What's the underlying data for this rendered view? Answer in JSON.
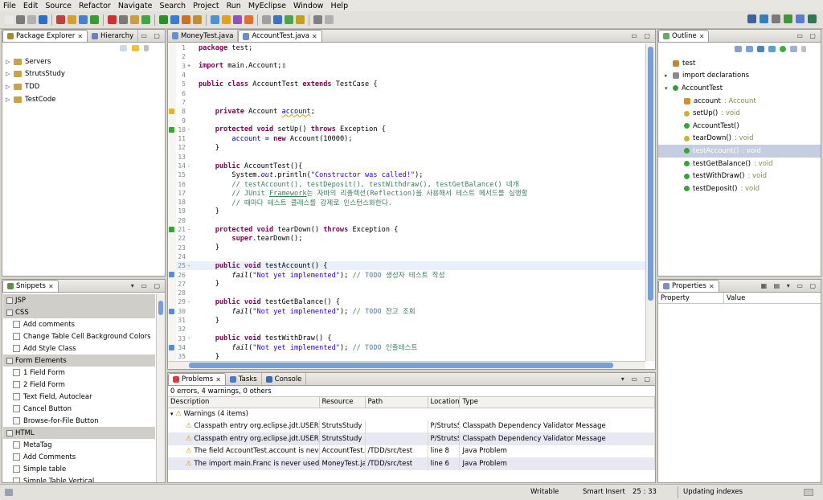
{
  "menu": [
    "File",
    "Edit",
    "Source",
    "Refactor",
    "Navigate",
    "Search",
    "Project",
    "Run",
    "MyEclipse",
    "Window",
    "Help"
  ],
  "package_explorer": {
    "tab_label": "Package Explorer",
    "tab2_label": "Hierarchy",
    "items": [
      "Servers",
      "StrutsStudy",
      "TDD",
      "TestCode"
    ]
  },
  "snippets": {
    "tab_label": "Snippets",
    "categories": [
      {
        "name": "JSP",
        "items": []
      },
      {
        "name": "CSS",
        "items": [
          "Add comments",
          "Change Table Cell Background Colors",
          "Add Style Class"
        ]
      },
      {
        "name": "Form Elements",
        "items": [
          "1 Field Form",
          "2 Field Form",
          "Text Field, Autoclear",
          "Cancel Button",
          "Browse-for-File Button"
        ]
      },
      {
        "name": "HTML",
        "items": [
          "MetaTag",
          "Add Comments",
          "Simple table",
          "Simple Table Vertical"
        ]
      }
    ]
  },
  "editor": {
    "tabs": [
      {
        "label": "MoneyTest.java",
        "active": false
      },
      {
        "label": "AccountTest.java",
        "active": true
      }
    ],
    "lines": [
      {
        "n": "1",
        "html": "<span class='kw'>package</span> test;"
      },
      {
        "n": "2",
        "html": ""
      },
      {
        "n": "3",
        "fold": "+",
        "html": "<span class='kw'>import</span> main.Account;&#9647;"
      },
      {
        "n": "4",
        "html": ""
      },
      {
        "n": "5",
        "html": "<span class='kw'>public class</span> AccountTest <span class='kw'>extends</span> TestCase {"
      },
      {
        "n": "6",
        "html": ""
      },
      {
        "n": "7",
        "html": ""
      },
      {
        "n": "8",
        "mark": "warn",
        "html": "    <span class='kw'>private</span> Account <span class='fld' style='text-decoration:underline wavy #d0a000'>account</span>;"
      },
      {
        "n": "9",
        "html": ""
      },
      {
        "n": "10",
        "fold": "-",
        "mark": "green",
        "html": "    <span class='kw'>protected void</span> setUp() <span class='kw'>throws</span> Exception {"
      },
      {
        "n": "11",
        "html": "        <span class='fld'>account</span> = <span class='kw'>new</span> Account(10000);"
      },
      {
        "n": "12",
        "html": "    }"
      },
      {
        "n": "13",
        "html": ""
      },
      {
        "n": "14",
        "fold": "-",
        "html": "    <span class='kw'>public</span> AccountTest(){"
      },
      {
        "n": "15",
        "html": "        System.<span class='fld it'>out</span>.println(<span class='str'>\"Constructor was called!\"</span>);"
      },
      {
        "n": "16",
        "html": "        <span class='cmt'>// testAccount(), testDeposit(), testWithdraw(), testGetBalance() 네개</span>"
      },
      {
        "n": "17",
        "html": "        <span class='cmt'>// JUnit <span style='text-decoration:underline'>Framework</span>는 자바의 리플렉션(Reflection)을 사용해서 테스트 메서드를 실행할</span>"
      },
      {
        "n": "18",
        "html": "        <span class='cmt'>// 때마다 테스트 클래스를 강제로 인스턴스화한다.</span>"
      },
      {
        "n": "19",
        "html": "    }"
      },
      {
        "n": "20",
        "html": ""
      },
      {
        "n": "21",
        "fold": "-",
        "mark": "green",
        "html": "    <span class='kw'>protected void</span> tearDown() <span class='kw'>throws</span> Exception {"
      },
      {
        "n": "22",
        "html": "        <span class='kw'>super</span>.tearDown();"
      },
      {
        "n": "23",
        "html": "    }"
      },
      {
        "n": "24",
        "html": ""
      },
      {
        "n": "25",
        "fold": "-",
        "hl": true,
        "html": "    <span class='kw'>public void</span> testAccount() {"
      },
      {
        "n": "26",
        "mark": "task",
        "html": "        <span class='it'>fail</span>(<span class='str'>\"Not yet implemented\"</span>); <span class='cmt'>// <span class='todo'>TODO</span> 생성자 테스트 작성</span>"
      },
      {
        "n": "27",
        "html": "    }"
      },
      {
        "n": "28",
        "html": ""
      },
      {
        "n": "29",
        "fold": "-",
        "html": "    <span class='kw'>public void</span> testGetBalance() {"
      },
      {
        "n": "30",
        "mark": "task",
        "html": "        <span class='it'>fail</span>(<span class='str'>\"Not yet implemented\"</span>); <span class='cmt'>// <span class='todo'>TODO</span> 잔고 조회</span>"
      },
      {
        "n": "31",
        "html": "    }"
      },
      {
        "n": "32",
        "html": ""
      },
      {
        "n": "33",
        "fold": "-",
        "html": "    <span class='kw'>public void</span> testWithDraw() {"
      },
      {
        "n": "34",
        "mark": "task",
        "html": "        <span class='it'>fail</span>(<span class='str'>\"Not yet implemented\"</span>); <span class='cmt'>// <span class='todo'>TODO</span> 인출테스트</span>"
      },
      {
        "n": "35",
        "html": "    }"
      },
      {
        "n": "36",
        "html": ""
      }
    ]
  },
  "outline": {
    "tab_label": "Outline",
    "items": [
      {
        "label": "test",
        "detail": "",
        "indent": 0,
        "icon": "package-icon"
      },
      {
        "label": "import declarations",
        "detail": "",
        "indent": 0,
        "arrow": "▸",
        "icon": "imports-icon"
      },
      {
        "label": "AccountTest",
        "detail": "",
        "indent": 0,
        "arrow": "▾",
        "icon": "class-icon"
      },
      {
        "label": "account",
        "detail": " : Account",
        "indent": 1,
        "icon": "field-private-icon"
      },
      {
        "label": "setUp()",
        "detail": " : void",
        "indent": 1,
        "icon": "method-protected-icon"
      },
      {
        "label": "AccountTest()",
        "detail": "",
        "indent": 1,
        "icon": "constructor-icon"
      },
      {
        "label": "tearDown()",
        "detail": " : void",
        "indent": 1,
        "icon": "method-protected-icon"
      },
      {
        "label": "testAccount()",
        "detail": " : void",
        "indent": 1,
        "icon": "method-public-icon",
        "selected": true
      },
      {
        "label": "testGetBalance()",
        "detail": " : void",
        "indent": 1,
        "icon": "method-public-icon"
      },
      {
        "label": "testWithDraw()",
        "detail": " : void",
        "indent": 1,
        "icon": "method-public-icon"
      },
      {
        "label": "testDeposit()",
        "detail": " : void",
        "indent": 1,
        "icon": "method-public-icon"
      }
    ]
  },
  "properties": {
    "tab_label": "Properties",
    "col_property": "Property",
    "col_value": "Value"
  },
  "problems": {
    "tabs": [
      "Problems",
      "Tasks",
      "Console"
    ],
    "summary": "0 errors, 4 warnings, 0 others",
    "columns": [
      "Description",
      "Resource",
      "Path",
      "Location",
      "Type"
    ],
    "group": "Warnings (4 items)",
    "rows": [
      {
        "description": "Classpath entry org.eclipse.jdt.USER_LIBRARY",
        "resource": "StrutsStudy",
        "path": "",
        "location": "P/StrutsStudy",
        "type": "Classpath Dependency Validator Message"
      },
      {
        "description": "Classpath entry org.eclipse.jdt.USER_LIBRARY",
        "resource": "StrutsStudy",
        "path": "",
        "location": "P/StrutsStudy",
        "type": "Classpath Dependency Validator Message"
      },
      {
        "description": "The field AccountTest.account is never read",
        "resource": "AccountTest.java",
        "path": "/TDD/src/test",
        "location": "line 8",
        "type": "Java Problem"
      },
      {
        "description": "The import main.Franc is never used",
        "resource": "MoneyTest.java",
        "path": "/TDD/src/test",
        "location": "line 6",
        "type": "Java Problem"
      }
    ]
  },
  "status": {
    "writable": "Writable",
    "insert_mode": "Smart Insert",
    "position": "25 : 33",
    "task": "Updating indexes"
  },
  "colors": {
    "keyword": "#7f0055",
    "string": "#2a00ff",
    "comment": "#3f7f5f",
    "selection": "#c5cde0"
  }
}
